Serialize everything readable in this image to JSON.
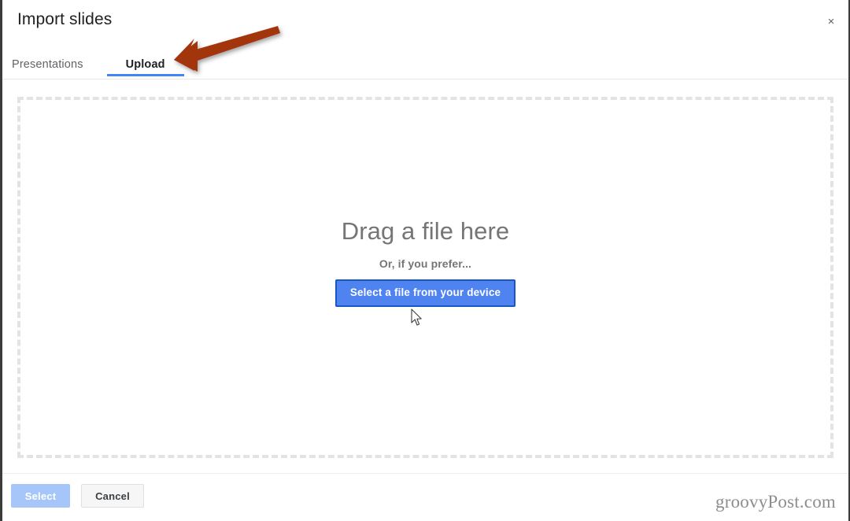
{
  "dialog": {
    "title": "Import slides",
    "close_icon": "close-icon",
    "close_label": "×"
  },
  "tabs": [
    {
      "label": "Presentations",
      "active": false
    },
    {
      "label": "Upload",
      "active": true
    }
  ],
  "dropzone": {
    "headline": "Drag a file here",
    "subtext": "Or, if you prefer...",
    "button_label": "Select a file from your device"
  },
  "footer": {
    "select_label": "Select",
    "select_disabled": true,
    "cancel_label": "Cancel"
  },
  "watermark": {
    "text": "groovyPost.com"
  },
  "annotation": {
    "type": "arrow",
    "color": "#a33409",
    "points_to": "Upload tab"
  },
  "colors": {
    "accent_blue": "#4285f4",
    "button_blue": "#4e83f0",
    "button_blue_border": "#1a56c4",
    "select_disabled_blue": "#a6c6fa",
    "dashed_border": "#e3e3e3",
    "text_gray": "#757575",
    "title_dark": "#212121",
    "annotation_red": "#a33409"
  }
}
